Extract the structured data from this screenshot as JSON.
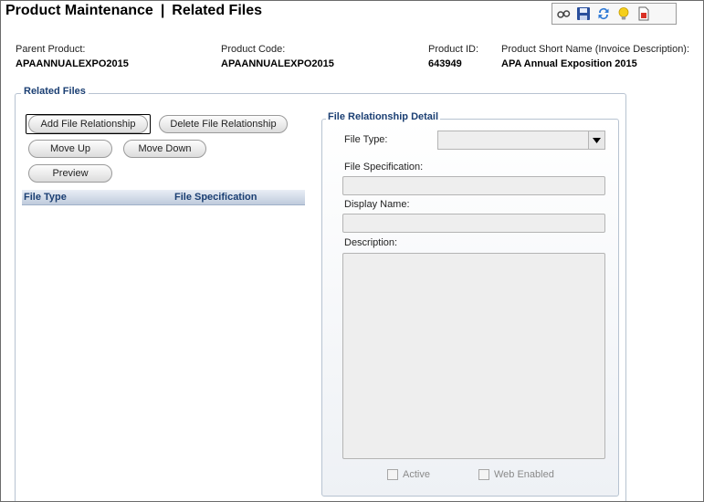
{
  "header": {
    "title_left": "Product Maintenance",
    "separator": "|",
    "title_right": "Related Files"
  },
  "toolbar": {
    "icons": [
      "glasses-icon",
      "save-icon",
      "refresh-icon",
      "lightbulb-icon",
      "report-icon"
    ]
  },
  "product_info": {
    "parent_product_label": "Parent Product:",
    "parent_product_value": "APAANNUALEXPO2015",
    "product_code_label": "Product Code:",
    "product_code_value": "APAANNUALEXPO2015",
    "product_id_label": "Product ID:",
    "product_id_value": "643949",
    "short_name_label": "Product Short Name (Invoice Description):",
    "short_name_value": "APA Annual Exposition 2015"
  },
  "related_files": {
    "legend": "Related Files",
    "buttons": {
      "add": "Add File Relationship",
      "delete": "Delete File Relationship",
      "move_up": "Move Up",
      "move_down": "Move Down",
      "preview": "Preview"
    },
    "columns": [
      "File Type",
      "File Specification"
    ],
    "rows": []
  },
  "detail": {
    "legend": "File Relationship Detail",
    "file_type_label": "File Type:",
    "file_type_value": "",
    "file_spec_label": "File Specification:",
    "file_spec_value": "",
    "display_name_label": "Display Name:",
    "display_name_value": "",
    "description_label": "Description:",
    "description_value": "",
    "active_label": "Active",
    "active_checked": false,
    "web_enabled_label": "Web Enabled",
    "web_enabled_checked": false
  },
  "colors": {
    "legend_blue": "#1b3f73",
    "group_border": "#b7c3d1",
    "disabled_field": "#eeeeee"
  }
}
